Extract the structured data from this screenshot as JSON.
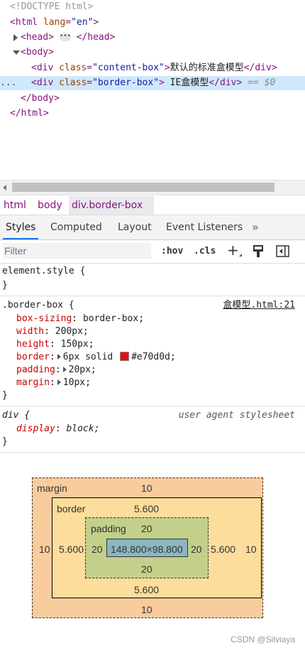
{
  "elements_tree": {
    "doctype": "<!DOCTYPE html>",
    "html_open_tag": "html",
    "html_lang_attr": "lang",
    "html_lang_value": "\"en\"",
    "head_tag": "head",
    "body_tag": "body",
    "div1": {
      "tag": "div",
      "attr": "class",
      "value": "\"content-box\"",
      "text": "默认的标准盒模型"
    },
    "div2": {
      "tag": "div",
      "attr": "class",
      "value": "\"border-box\"",
      "text": " IE盒模型",
      "console_ref": "== $0"
    },
    "selected_row_gutter": "..."
  },
  "breadcrumb": [
    "html",
    "body",
    "div.border-box"
  ],
  "tabs": {
    "items": [
      "Styles",
      "Computed",
      "Layout",
      "Event Listeners"
    ],
    "active": "Styles",
    "more": "»"
  },
  "filter": {
    "placeholder": "Filter",
    "hov": ":hov",
    "cls": ".cls",
    "new_rule": "+"
  },
  "styles": {
    "element_style": {
      "selector": "element.style {",
      "close": "}"
    },
    "border_box_rule": {
      "selector": ".border-box {",
      "source": "盒模型.html:21",
      "close": "}",
      "declarations": [
        {
          "name": "box-sizing",
          "value": "border-box;"
        },
        {
          "name": "width",
          "value": "200px;"
        },
        {
          "name": "height",
          "value": "150px;"
        },
        {
          "name": "border",
          "value": "6px solid",
          "color_text": "#e70d0d;"
        },
        {
          "name": "padding",
          "value": "20px;"
        },
        {
          "name": "margin",
          "value": "10px;"
        }
      ],
      "border_color": "#e70d0d"
    },
    "ua_rule": {
      "selector": "div {",
      "source": "user agent stylesheet",
      "close": "}",
      "declaration": {
        "name": "display",
        "value": "block;"
      }
    }
  },
  "box_model": {
    "margin": {
      "label": "margin",
      "top": "10",
      "right": "10",
      "bottom": "10",
      "left": "10"
    },
    "border": {
      "label": "border",
      "top": "5.600",
      "right": "5.600",
      "bottom": "5.600",
      "left": "5.600"
    },
    "padding": {
      "label": "padding",
      "top": "20",
      "right": "20",
      "bottom": "20",
      "left": "20"
    },
    "content": "148.800×98.800"
  },
  "watermark": "CSDN @Silviaya",
  "colors": {
    "accent": "#1a73e8",
    "tag": "#881280",
    "attr_name": "#994500",
    "attr_value": "#1a1aa6",
    "selection": "#cfe8fc"
  }
}
